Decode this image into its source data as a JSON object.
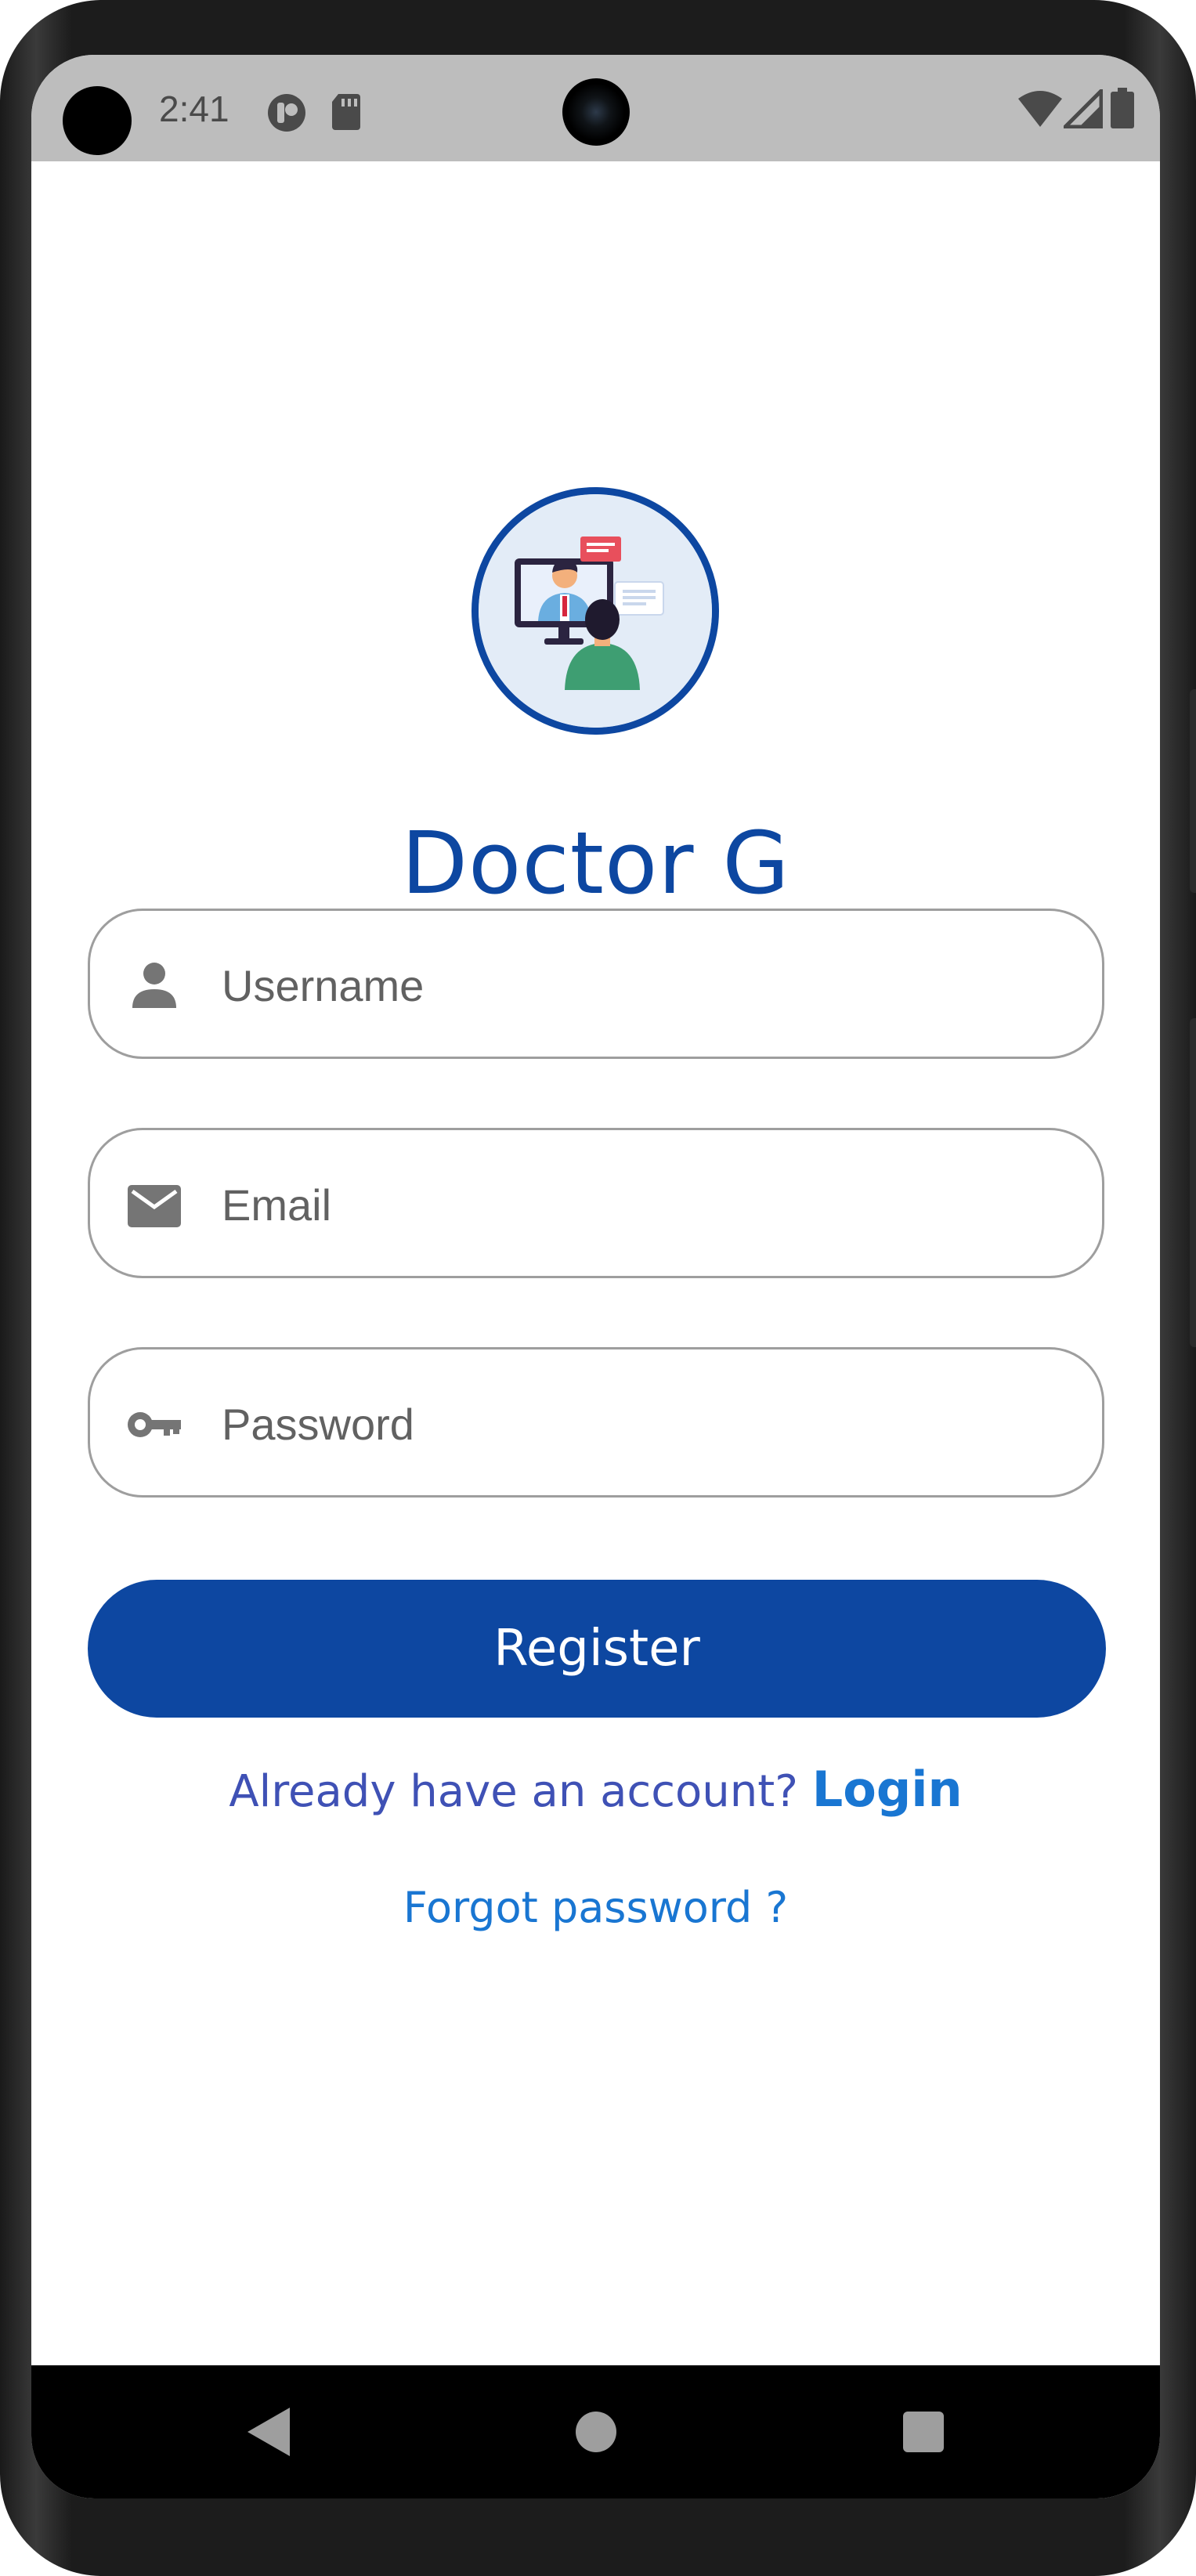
{
  "status_bar": {
    "time": "2:41",
    "icons": [
      "notification-app-icon",
      "sd-card-icon",
      "wifi-icon",
      "cell-signal-icon",
      "battery-icon"
    ]
  },
  "app": {
    "title": "Doctor G",
    "logo_icon": "doctor-consultation-logo"
  },
  "form": {
    "username": {
      "placeholder": "Username",
      "icon": "person-icon"
    },
    "email": {
      "placeholder": "Email",
      "icon": "mail-icon"
    },
    "password": {
      "placeholder": "Password",
      "icon": "key-icon"
    },
    "register_label": "Register",
    "login_prompt": "Already have an account?",
    "login_label": "Login",
    "forgot_label": "Forgot password ?"
  },
  "nav_bar": {
    "icons": [
      "back-icon",
      "home-icon",
      "recents-icon"
    ]
  },
  "colors": {
    "primary": "#0d47a1",
    "link": "#1976d2",
    "prompt_text": "#3f51b5",
    "field_border": "#9e9e9e",
    "status_bar_bg": "#bdbdbd"
  }
}
